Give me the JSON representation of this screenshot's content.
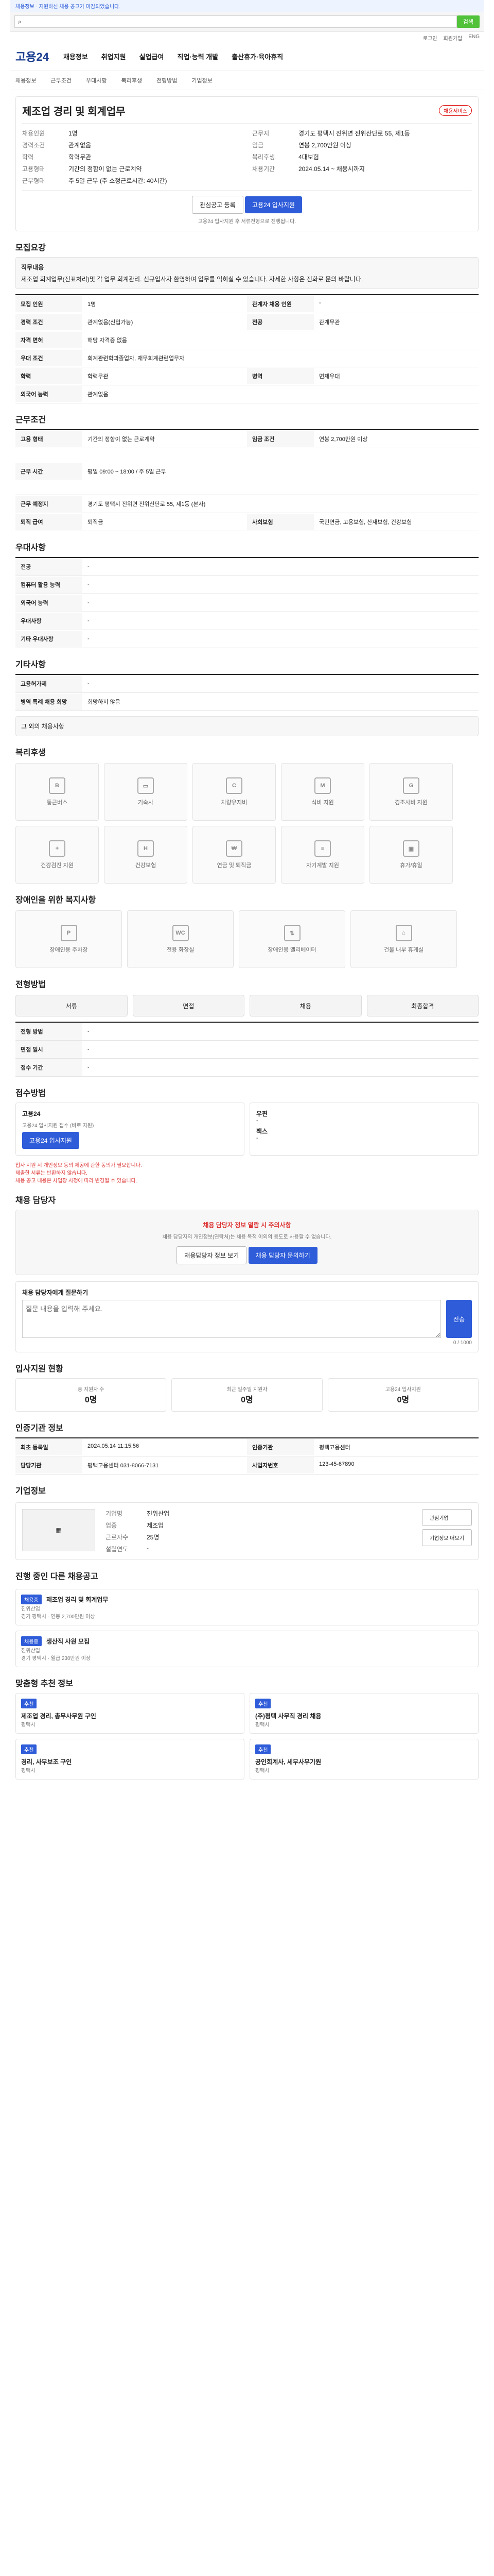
{
  "notice": "채용정보 · 지원하신 채용 공고가 마감되었습니다.",
  "top": {
    "search_placeholder": "",
    "search_button": "검색"
  },
  "utility": [
    "로그인",
    "회원가입",
    "ENG"
  ],
  "header": {
    "logo": "고용24",
    "nav": [
      "채용정보",
      "취업지원",
      "실업급여",
      "직업·능력 개발",
      "출산휴가·육아휴직"
    ]
  },
  "subnav": [
    "채용정보",
    "근무조건",
    "우대사항",
    "복리후생",
    "전형방법",
    "기업정보"
  ],
  "job": {
    "title": "제조업 경리 및 회계업무",
    "badge": "채용서비스",
    "left": [
      {
        "k": "채용인원",
        "v": "1명"
      },
      {
        "k": "경력조건",
        "v": "관계없음"
      },
      {
        "k": "학력",
        "v": "학력무관"
      },
      {
        "k": "고용형태",
        "v": "기간의 정함이 없는 근로계약"
      },
      {
        "k": "근무형태",
        "v": "주 5일 근무 (주 소정근로시간: 40시간)"
      }
    ],
    "right": [
      {
        "k": "근무지",
        "v": "경기도 평택시 진위면 진위산단로 55, 제1동"
      },
      {
        "k": "임금",
        "v": "연봉 2,700만원 이상"
      },
      {
        "k": "복리후생",
        "v": "4대보험"
      },
      {
        "k": "채용기간",
        "v": "2024.05.14 ~ 채용시까지"
      }
    ],
    "apply_interest": "관심공고 등록",
    "apply_online": "고용24 입사지원",
    "apply_note": "고용24 입사지원 후 서류전형으로 진행됩니다."
  },
  "intro": {
    "title": "모집요강",
    "body_title": "직무내용",
    "body": "제조업 회계업무(전표처리)및 각 업무 회계관리. 신규입사자 환영하며 업무를 익히실 수 있습니다. 자세한 사항은 전화로 문의 바랍니다."
  },
  "recruit_table": [
    {
      "k": "모집 인원",
      "v": "1명",
      "k2": "관계자 채용 인원",
      "v2": "-"
    },
    {
      "k": "경력 조건",
      "v": "관계없음(신입가능)",
      "k2": "전공",
      "v2": "관계무관"
    },
    {
      "k": "자격 면허",
      "v": "해당 자격증 없음",
      "k2": "",
      "v2": ""
    },
    {
      "k": "우대 조건",
      "v": "회계관련학과졸업자, 재무회계관련업무자",
      "k2": "",
      "v2": ""
    },
    {
      "k": "학력",
      "v": "학력무관",
      "k2": "병역",
      "v2": "면제우대"
    },
    {
      "k": "외국어 능력",
      "v": "관계없음",
      "k2": "",
      "v2": ""
    }
  ],
  "work": {
    "title": "근무조건",
    "rows": [
      {
        "k": "고용 형태",
        "v": "기간의 정함이 없는 근로계약",
        "k2": "임금 조건",
        "v2": "연봉 2,700만원 이상"
      },
      {
        "k": "근무 시간",
        "v": "평일 09:00 ~ 18:00 / 주 5일 근무",
        "k2": "",
        "v2": ""
      },
      {
        "k": "근무 예정지",
        "v": "경기도 평택시 진위면 진위산단로 55, 제1동 (본사)",
        "k2": "",
        "v2": ""
      },
      {
        "k": "퇴직 급여",
        "v": "퇴직금",
        "k2": "사회보험",
        "v2": "국민연금, 고용보험, 산재보험, 건강보험"
      }
    ]
  },
  "preference": {
    "title": "우대사항",
    "rows": [
      {
        "k": "전공",
        "v": "-"
      },
      {
        "k": "컴퓨터 활용 능력",
        "v": "-"
      },
      {
        "k": "외국어 능력",
        "v": "-"
      },
      {
        "k": "우대사항",
        "v": "-"
      },
      {
        "k": "기타 우대사항",
        "v": "-"
      }
    ]
  },
  "other": {
    "title": "기타사항",
    "rows": [
      {
        "k": "고용허가제",
        "v": "-"
      },
      {
        "k": "병역 특례 채용 희망",
        "v": "희망하지 않음"
      }
    ],
    "note": "그 외의 채용사항"
  },
  "welfare": {
    "title": "복리후생",
    "items": [
      "통근버스",
      "기숙사",
      "차량유지비",
      "식비 지원",
      "경조사비 지원",
      "건강검진 지원",
      "건강보험",
      "연금 및 퇴직금",
      "자기계발 지원",
      "휴가/휴일"
    ]
  },
  "disability": {
    "title": "장애인을 위한 복지사항",
    "items": [
      "장애인용 주차장",
      "전용 화장실",
      "장애인용 엘리베이터",
      "건물 내부 휴게실"
    ]
  },
  "selection": {
    "title": "전형방법",
    "steps": [
      "서류",
      "면접",
      "채용",
      "최종합격"
    ],
    "rows": [
      {
        "k": "전형 방법",
        "v": "-"
      },
      {
        "k": "면접 일시",
        "v": "-"
      },
      {
        "k": "접수 기간",
        "v": "-"
      }
    ]
  },
  "apply": {
    "title": "접수방법",
    "online_title": "고용24",
    "online_body": "고용24 입사지원 접수 (바로 지원)",
    "online_button": "고용24 입사지원",
    "mail_title": "우편",
    "mail_body": "-",
    "fax_title": "팩스",
    "fax_body": "-",
    "notes": [
      "입사 지원 시 개인정보 등의 제공에 관한 동의가 필요합니다.",
      "제출한 서류는 반환하지 않습니다.",
      "채용 공고 내용은 사업장 사정에 따라 변경될 수 있습니다."
    ]
  },
  "contact": {
    "title": "채용 담당자",
    "alert_title": "채용 담당자 정보 열람 시 주의사항",
    "alert_body": "채용 담당자의 개인정보(연락처)는 채용 목적 이외의 용도로 사용할 수 없습니다.",
    "btn1": "채용담당자 정보 보기",
    "btn2": "채용 담당자 문의하기",
    "inquiry_title": "채용 담당자에게 질문하기",
    "inquiry_placeholder": "질문 내용을 입력해 주세요.",
    "inquiry_button": "전송",
    "inquiry_counter": "0 / 1000"
  },
  "stats": {
    "title": "입사지원 현황",
    "boxes": [
      {
        "label": "총 지원자 수",
        "value": "0명"
      },
      {
        "label": "최근 일주일 지원자",
        "value": "0명"
      },
      {
        "label": "고용24 입사지원",
        "value": "0명"
      }
    ]
  },
  "company_info": {
    "title": "인증기관 정보",
    "rows": [
      {
        "k": "최초 등록일",
        "v": "2024.05.14 11:15:56",
        "k2": "인증기관",
        "v2": "평택고용센터"
      },
      {
        "k": "담당기관",
        "v": "평택고용센터 031-8066-7131",
        "k2": "사업자번호",
        "v2": "123-45-67890"
      }
    ]
  },
  "company": {
    "title": "기업정보",
    "rows": [
      {
        "k": "기업명",
        "v": "진위산업"
      },
      {
        "k": "업종",
        "v": "제조업"
      },
      {
        "k": "근로자수",
        "v": "25명"
      },
      {
        "k": "설립연도",
        "v": "-"
      }
    ],
    "btn_follow": "관심기업",
    "btn_more": "기업정보 더보기"
  },
  "related": {
    "title": "진행 중인 다른 채용공고",
    "cards": [
      {
        "tag": "채용중",
        "title": "제조업 경리 및 회계업무",
        "company": "진위산업",
        "meta": "경기 평택시 · 연봉 2,700만원 이상"
      },
      {
        "tag": "채용중",
        "title": "생산직 사원 모집",
        "company": "진위산업",
        "meta": "경기 평택시 · 월급 230만원 이상"
      }
    ]
  },
  "ads": {
    "title": "맞춤형 추천 정보",
    "cards": [
      {
        "tag": "추천",
        "title": "제조업 경리, 총무사무원 구인",
        "sub": "평택시"
      },
      {
        "tag": "추천",
        "title": "(주)평택 사무직 경리 채용",
        "sub": "평택시"
      },
      {
        "tag": "추천",
        "title": "경리, 사무보조 구인",
        "sub": "평택시"
      },
      {
        "tag": "추천",
        "title": "공인회계사, 세무사무기원",
        "sub": "평택시"
      }
    ]
  }
}
